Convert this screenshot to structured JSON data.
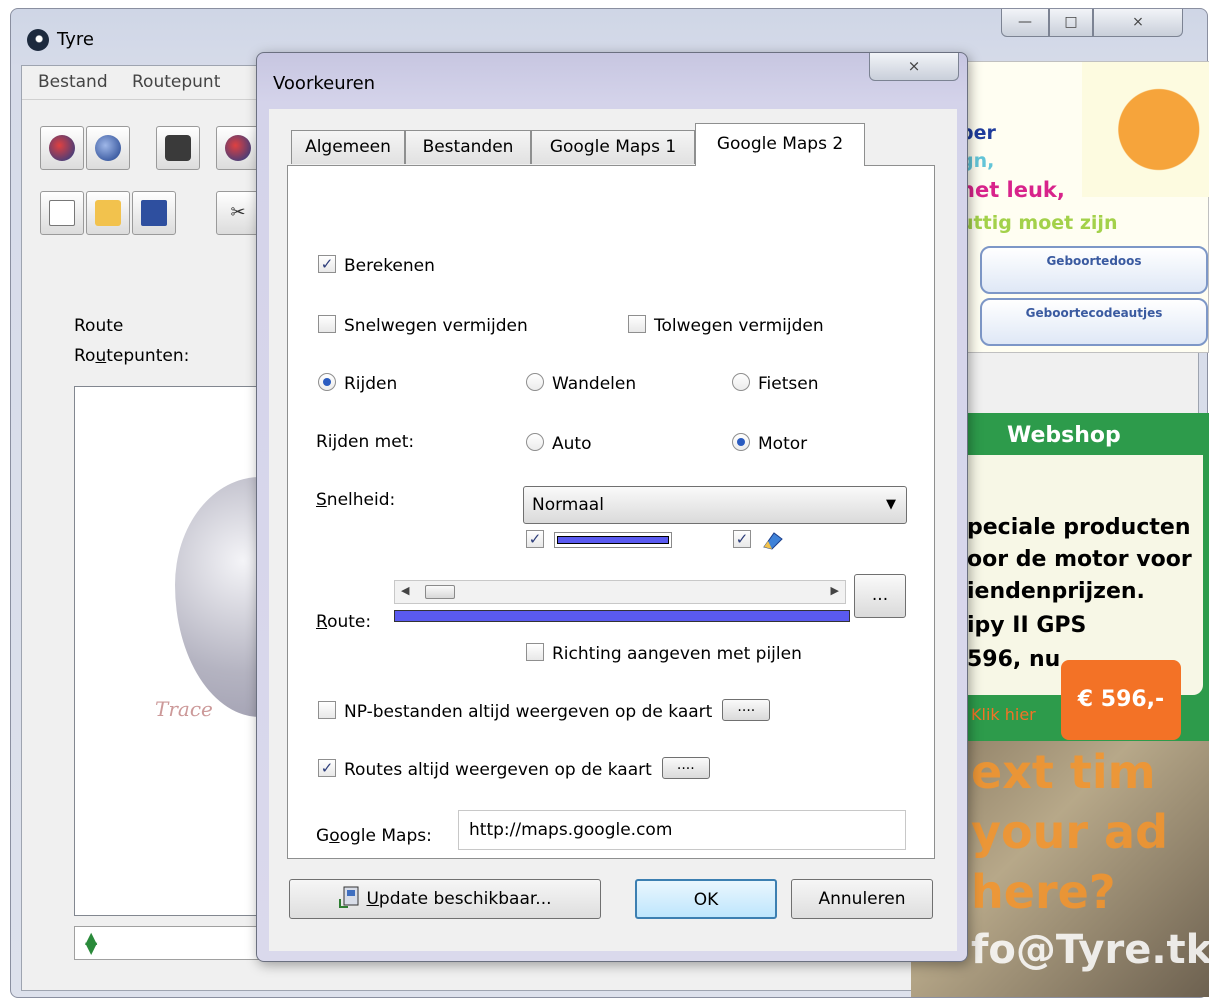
{
  "main_window": {
    "title": "Tyre",
    "caption": {
      "minimize": "—",
      "maximize": "□",
      "close": "⨯"
    },
    "menu": [
      "Bestand",
      "Routepunt"
    ],
    "route_group": "Route",
    "routepunten_pre": "Ro",
    "routepunten_ul": "u",
    "routepunten_post": "tepunten:",
    "logo_text": "Trace"
  },
  "advert": {
    "top_lines": [
      "per",
      "gn,",
      "het leuk,",
      "uttig moet zijn"
    ],
    "pills": [
      "Geboortedoos",
      "Geboortecodeautjes"
    ],
    "webshop": "Webshop",
    "mid_lines": [
      "peciale producten",
      "oor de motor voor",
      "iendenprijzen.",
      "ipy II GPS",
      "596, nu"
    ],
    "price": "€ 596,-",
    "klik": "Klik hier",
    "bottom_lines": [
      "ext tim",
      "your ad",
      "here?",
      "fo@Tyre.tk"
    ]
  },
  "dialog": {
    "title": "Voorkeuren",
    "close": "⨯",
    "tabs": [
      "Algemeen",
      "Bestanden",
      "Google Maps 1",
      "Google Maps 2"
    ],
    "berekenen": "Berekenen",
    "snelwegen": "Snelwegen vermijden",
    "tolwegen": "Tolwegen vermijden",
    "rijden": "Rijden",
    "wandelen": "Wandelen",
    "fietsen": "Fietsen",
    "rijden_met": "Rijden met:",
    "auto": "Auto",
    "motor": "Motor",
    "snelheid_ul": "S",
    "snelheid_rest": "nelheid:",
    "snelheid_value": "Normaal",
    "route_ul": "R",
    "route_rest": "oute:",
    "route_dots": "...",
    "richting": "Richting aangeven met pijlen",
    "np_bestanden": "NP-bestanden altijd weergeven op de kaart",
    "np_dots": "....",
    "routes_altijd": "Routes altijd weergeven op de kaart",
    "routes_dots": "....",
    "gmaps_pre": "G",
    "gmaps_ul": "o",
    "gmaps_post": "ogle Maps:",
    "gmaps_url": "http://maps.google.com",
    "update_ul": "U",
    "update_rest": "pdate beschikbaar...",
    "ok": "OK",
    "annuleren": "Annuleren",
    "check_mark": "✓",
    "arrow_down": "▼",
    "arrow_left": "◀",
    "arrow_right": "▶"
  },
  "state": {
    "berekenen": true,
    "snelwegen": false,
    "tolwegen": false,
    "mode": "Rijden",
    "vehicle": "Motor",
    "line_checkbox": true,
    "icon_checkbox": true,
    "richting": false,
    "np_bestanden": false,
    "routes_altijd": true
  },
  "colors": {
    "route_line": "#5a5af0",
    "ok_border": "#3c7fb1",
    "ad_green": "#2d9b4b",
    "ad_orange": "#f37226"
  },
  "icons": [
    "tyre-logo-icon",
    "globe-icon",
    "binoculars-icon",
    "new-file-icon",
    "open-folder-icon",
    "save-icon",
    "cut-icon",
    "pen-icon",
    "update-icon",
    "spinner-arrows-icon"
  ]
}
